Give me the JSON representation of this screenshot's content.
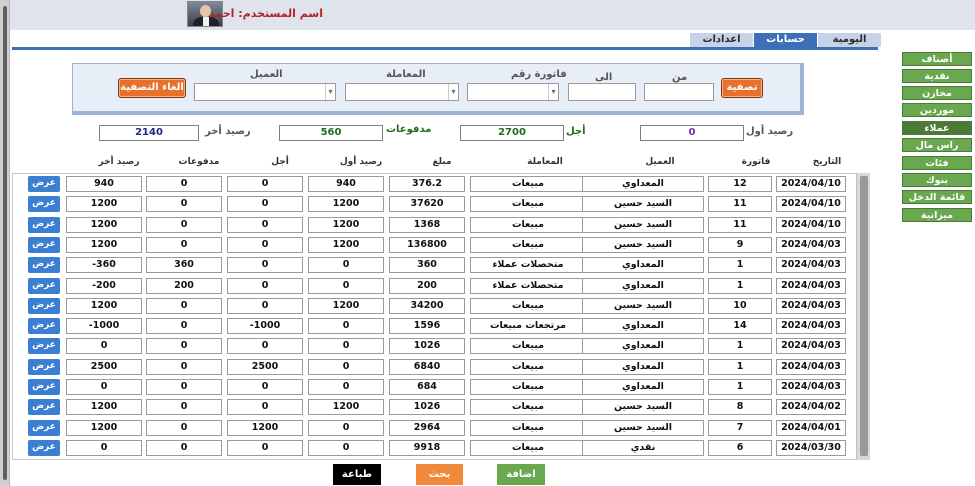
{
  "header": {
    "user_label": "اسم المستخدم: احمد"
  },
  "tabs": [
    {
      "label": "اليومية",
      "active": false
    },
    {
      "label": "حسابات",
      "active": true
    },
    {
      "label": "اعدادات",
      "active": false
    }
  ],
  "filter": {
    "from_label": "من",
    "to_label": "الى",
    "invoice_label": "فاتورة رقم",
    "transaction_label": "المعاملة",
    "customer_label": "العميل",
    "filter_button": "تصفية",
    "cancel_filter_button": "الغاء التصفية",
    "from_value": "",
    "to_value": "",
    "invoice_value": "",
    "transaction_value": "",
    "customer_value": ""
  },
  "summary": {
    "opening_label": "رصيد أول",
    "opening_value": "0",
    "deferred_label": "أجل",
    "deferred_value": "2700",
    "payments_label": "مدفوعات",
    "payments_value": "560",
    "closing_label": "رصيد أخر",
    "closing_value": "2140"
  },
  "table": {
    "columns": {
      "date": "التاريخ",
      "invoice": "فاتورة",
      "customer": "العميل",
      "transaction": "المعاملة",
      "amount": "مبلغ",
      "opening": "رصيد أول",
      "deferred": "أجل",
      "payments": "مدفوعات",
      "closing": "رصيد أخر"
    },
    "view_label": "عرض",
    "rows": [
      {
        "date": "2024/04/10",
        "invoice": "12",
        "customer": "المعداوي",
        "transaction": "مبيعات",
        "amount": "376.2",
        "opening": "940",
        "deferred": "0",
        "payments": "0",
        "closing": "940"
      },
      {
        "date": "2024/04/10",
        "invoice": "11",
        "customer": "السيد حسين",
        "transaction": "مبيعات",
        "amount": "37620",
        "opening": "1200",
        "deferred": "0",
        "payments": "0",
        "closing": "1200"
      },
      {
        "date": "2024/04/10",
        "invoice": "11",
        "customer": "السيد حسين",
        "transaction": "مبيعات",
        "amount": "1368",
        "opening": "1200",
        "deferred": "0",
        "payments": "0",
        "closing": "1200"
      },
      {
        "date": "2024/04/03",
        "invoice": "9",
        "customer": "السيد حسين",
        "transaction": "مبيعات",
        "amount": "136800",
        "opening": "1200",
        "deferred": "0",
        "payments": "0",
        "closing": "1200"
      },
      {
        "date": "2024/04/03",
        "invoice": "1",
        "customer": "المعداوي",
        "transaction": "متحصلات عملاء",
        "amount": "360",
        "opening": "0",
        "deferred": "0",
        "payments": "360",
        "closing": "-360"
      },
      {
        "date": "2024/04/03",
        "invoice": "1",
        "customer": "المعداوي",
        "transaction": "متحصلات عملاء",
        "amount": "200",
        "opening": "0",
        "deferred": "0",
        "payments": "200",
        "closing": "-200"
      },
      {
        "date": "2024/04/03",
        "invoice": "10",
        "customer": "السيد حسين",
        "transaction": "مبيعات",
        "amount": "34200",
        "opening": "1200",
        "deferred": "0",
        "payments": "0",
        "closing": "1200"
      },
      {
        "date": "2024/04/03",
        "invoice": "14",
        "customer": "المعداوي",
        "transaction": "مرتجعات مبيعات",
        "amount": "1596",
        "opening": "0",
        "deferred": "-1000",
        "payments": "0",
        "closing": "-1000"
      },
      {
        "date": "2024/04/03",
        "invoice": "1",
        "customer": "المعداوي",
        "transaction": "مبيعات",
        "amount": "1026",
        "opening": "0",
        "deferred": "0",
        "payments": "0",
        "closing": "0"
      },
      {
        "date": "2024/04/03",
        "invoice": "1",
        "customer": "المعداوي",
        "transaction": "مبيعات",
        "amount": "6840",
        "opening": "0",
        "deferred": "2500",
        "payments": "0",
        "closing": "2500"
      },
      {
        "date": "2024/04/03",
        "invoice": "1",
        "customer": "المعداوي",
        "transaction": "مبيعات",
        "amount": "684",
        "opening": "0",
        "deferred": "0",
        "payments": "0",
        "closing": "0"
      },
      {
        "date": "2024/04/02",
        "invoice": "8",
        "customer": "السيد حسين",
        "transaction": "مبيعات",
        "amount": "1026",
        "opening": "1200",
        "deferred": "0",
        "payments": "0",
        "closing": "1200"
      },
      {
        "date": "2024/04/01",
        "invoice": "7",
        "customer": "السيد حسين",
        "transaction": "مبيعات",
        "amount": "2964",
        "opening": "0",
        "deferred": "1200",
        "payments": "0",
        "closing": "1200"
      },
      {
        "date": "2024/03/30",
        "invoice": "6",
        "customer": "نقدي",
        "transaction": "مبيعات",
        "amount": "9918",
        "opening": "0",
        "deferred": "0",
        "payments": "0",
        "closing": "0"
      }
    ]
  },
  "actions": {
    "add": "اضافة",
    "search": "بحث",
    "print": "طباعة"
  },
  "nav": [
    {
      "label": "أصناف",
      "active": false
    },
    {
      "label": "نقدية",
      "active": false
    },
    {
      "label": "مخازن",
      "active": false
    },
    {
      "label": "موردين",
      "active": false
    },
    {
      "label": "عملاء",
      "active": true
    },
    {
      "label": "راس مال",
      "active": false
    },
    {
      "label": "فئات",
      "active": false
    },
    {
      "label": "بنوك",
      "active": false
    },
    {
      "label": "قائمة الدخل",
      "active": false
    },
    {
      "label": "ميزانية",
      "active": false
    }
  ],
  "colors": {
    "accent_blue": "#3c6fb6",
    "orange": "#e8702a",
    "green": "#6aa84f",
    "opening_text": "#7a2aa8",
    "deferred_text": "#1f6b1f",
    "closing_text": "#1d2a80"
  }
}
